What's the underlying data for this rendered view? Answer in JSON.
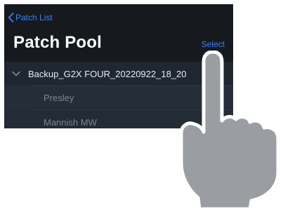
{
  "nav": {
    "back_label": "Patch List"
  },
  "header": {
    "title": "Patch Pool",
    "select_label": "Select"
  },
  "list": {
    "group": {
      "label": "Backup_G2X FOUR_20220922_18_20"
    },
    "items": [
      {
        "label": "Presley"
      },
      {
        "label": "Mannish MW"
      }
    ]
  },
  "colors": {
    "background": "#161a1f",
    "accent": "#3b82f6",
    "hand": "#9a9ea3"
  }
}
